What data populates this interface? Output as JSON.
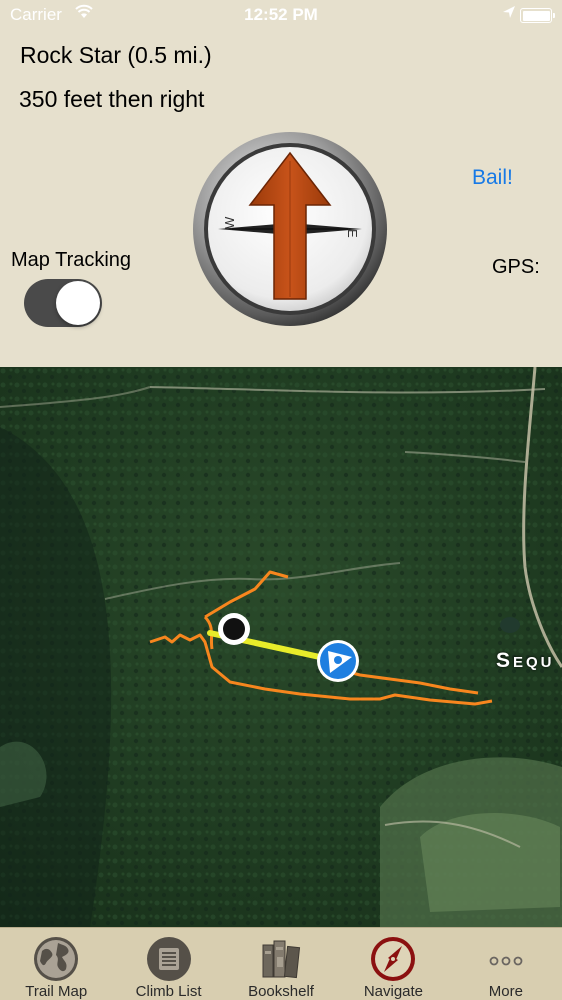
{
  "status_bar": {
    "carrier": "Carrier",
    "time": "12:52 PM"
  },
  "navigation": {
    "climb_name": "Rock Star (0.5 mi.)",
    "direction": "350 feet then right",
    "bail_label": "Bail!",
    "gps_label": "GPS:",
    "map_tracking_label": "Map Tracking",
    "map_tracking_on": true
  },
  "map": {
    "place_label": "Sequ"
  },
  "tab_bar": {
    "items": [
      {
        "label": "Trail Map",
        "icon": "globe-icon"
      },
      {
        "label": "Climb List",
        "icon": "list-icon"
      },
      {
        "label": "Bookshelf",
        "icon": "books-icon"
      },
      {
        "label": "Navigate",
        "icon": "compass-icon"
      },
      {
        "label": "More",
        "icon": "more-icon"
      }
    ],
    "active_index": 3
  },
  "colors": {
    "background": "#e6e0cd",
    "accent_blue": "#1679e6",
    "trail_orange": "#f7861e",
    "route_yellow": "#e8ec2a",
    "arrow_brown": "#b6470f",
    "active_tab_red": "#8b1010"
  }
}
